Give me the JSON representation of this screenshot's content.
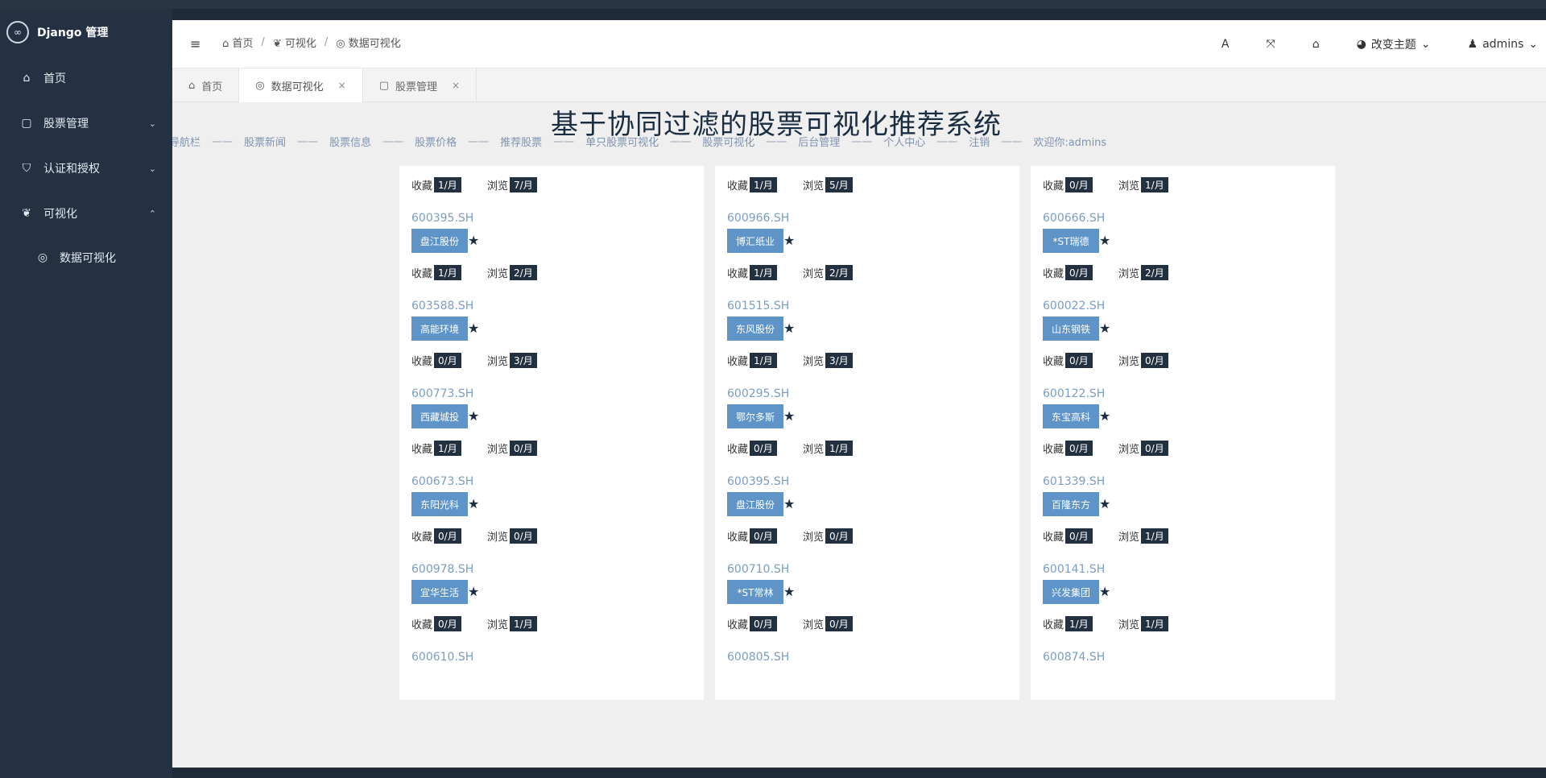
{
  "app": {
    "brand": "Django 管理",
    "logo_glyph": "∞"
  },
  "sidebar": {
    "items": [
      {
        "label": "首页",
        "icon": "home-icon",
        "glyph": "⌂",
        "chevron": ""
      },
      {
        "label": "股票管理",
        "icon": "file-icon",
        "glyph": "▢",
        "chevron": "⌄"
      },
      {
        "label": "认证和授权",
        "icon": "shield-icon",
        "glyph": "⛉",
        "chevron": "⌄"
      },
      {
        "label": "可视化",
        "icon": "leaf-icon",
        "glyph": "❦",
        "chevron": "⌃"
      }
    ],
    "sub": {
      "label": "数据可视化",
      "icon": "dashboard-icon",
      "glyph": "◎"
    }
  },
  "header": {
    "menu_glyph": "≡",
    "breadcrumb": [
      {
        "label": "首页",
        "glyph": "⌂"
      },
      {
        "label": "可视化",
        "glyph": "❦"
      },
      {
        "label": "数据可视化",
        "glyph": "◎"
      }
    ],
    "separator": "/",
    "font_btn": "A",
    "fullscreen_glyph": "⤧",
    "home_glyph": "⌂",
    "theme_label": "改变主题",
    "theme_glyph": "◕",
    "chev": "⌄",
    "user_label": "admins",
    "user_glyph": "♟"
  },
  "tabs": [
    {
      "label": "首页",
      "glyph": "⌂",
      "close": ""
    },
    {
      "label": "数据可视化",
      "glyph": "◎",
      "close": "×"
    },
    {
      "label": "股票管理",
      "glyph": "▢",
      "close": "×"
    }
  ],
  "page": {
    "title": "基于协同过滤的股票可视化推荐系统",
    "topnav": [
      "导航栏",
      "股票新闻",
      "股票信息",
      "股票价格",
      "推荐股票",
      "单只股票可视化",
      "股票可视化",
      "后台管理",
      "个人中心",
      "注销",
      "欢迎你:admins"
    ],
    "dash": "一一",
    "fav_label": "收藏",
    "view_label": "浏览",
    "star_glyph": "★"
  },
  "cards": [
    {
      "fav": "1/月",
      "view": "7/月",
      "code": "600395.SH",
      "name": "盘江股份"
    },
    {
      "fav": "1/月",
      "view": "5/月",
      "code": "600966.SH",
      "name": "博汇纸业"
    },
    {
      "fav": "0/月",
      "view": "1/月",
      "code": "600666.SH",
      "name": "*ST瑞德"
    },
    {
      "fav": "1/月",
      "view": "2/月",
      "code": "603588.SH",
      "name": "高能环境"
    },
    {
      "fav": "1/月",
      "view": "2/月",
      "code": "601515.SH",
      "name": "东风股份"
    },
    {
      "fav": "0/月",
      "view": "2/月",
      "code": "600022.SH",
      "name": "山东钢铁"
    },
    {
      "fav": "0/月",
      "view": "3/月",
      "code": "600773.SH",
      "name": "西藏城投"
    },
    {
      "fav": "1/月",
      "view": "3/月",
      "code": "600295.SH",
      "name": "鄂尔多斯"
    },
    {
      "fav": "0/月",
      "view": "0/月",
      "code": "600122.SH",
      "name": "东宝高科"
    },
    {
      "fav": "1/月",
      "view": "0/月",
      "code": "600673.SH",
      "name": "东阳光科"
    },
    {
      "fav": "0/月",
      "view": "1/月",
      "code": "600395.SH",
      "name": "盘江股份"
    },
    {
      "fav": "0/月",
      "view": "0/月",
      "code": "601339.SH",
      "name": "百隆东方"
    },
    {
      "fav": "0/月",
      "view": "0/月",
      "code": "600978.SH",
      "name": "宜华生活"
    },
    {
      "fav": "0/月",
      "view": "0/月",
      "code": "600710.SH",
      "name": "*ST常林"
    },
    {
      "fav": "0/月",
      "view": "1/月",
      "code": "600141.SH",
      "name": "兴发集团"
    },
    {
      "fav": "0/月",
      "view": "1/月",
      "code": "600610.SH",
      "name": ""
    },
    {
      "fav": "0/月",
      "view": "0/月",
      "code": "600805.SH",
      "name": ""
    },
    {
      "fav": "1/月",
      "view": "1/月",
      "code": "600874.SH",
      "name": ""
    }
  ]
}
